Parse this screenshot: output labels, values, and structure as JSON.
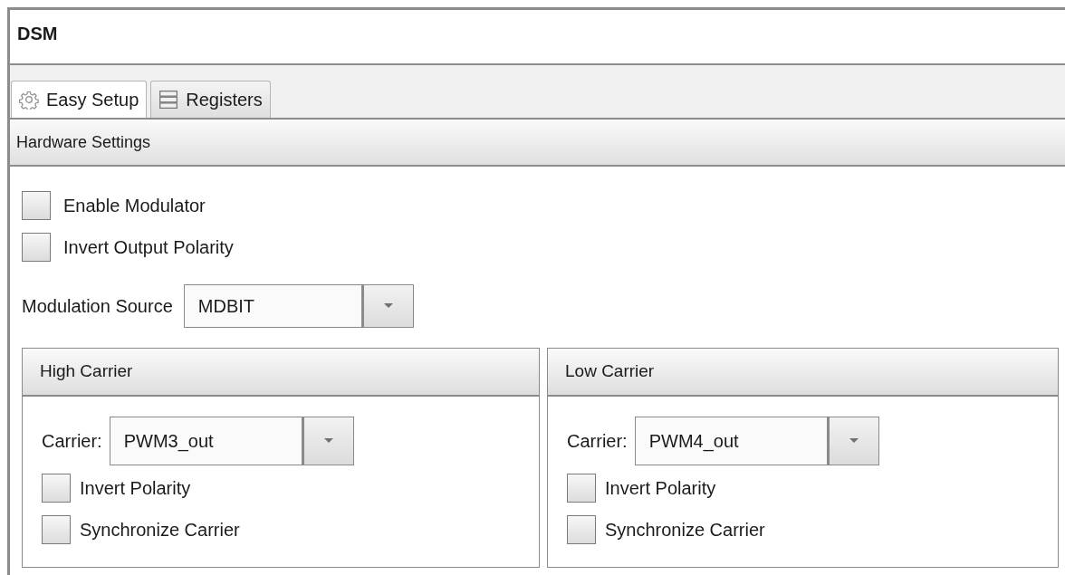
{
  "window": {
    "title": "DSM"
  },
  "tabs": [
    {
      "label": "Easy Setup",
      "kind": "setup",
      "selected": true
    },
    {
      "label": "Registers",
      "kind": "registers",
      "selected": false
    }
  ],
  "section": {
    "title": "Hardware Settings"
  },
  "options": [
    {
      "label": "Enable Modulator",
      "checked": false
    },
    {
      "label": "Invert Output Polarity",
      "checked": false
    }
  ],
  "modulation_source": {
    "label": "Modulation Source",
    "value": "MDBIT"
  },
  "groups": [
    {
      "title": "High Carrier",
      "carrier_label": "Carrier:",
      "carrier_value": "PWM3_out",
      "options": [
        {
          "label": "Invert Polarity",
          "checked": false
        },
        {
          "label": "Synchronize Carrier",
          "checked": false
        }
      ]
    },
    {
      "title": "Low Carrier",
      "carrier_label": "Carrier:",
      "carrier_value": "PWM4_out",
      "options": [
        {
          "label": "Invert Polarity",
          "checked": false
        },
        {
          "label": "Synchronize Carrier",
          "checked": false
        }
      ]
    }
  ]
}
